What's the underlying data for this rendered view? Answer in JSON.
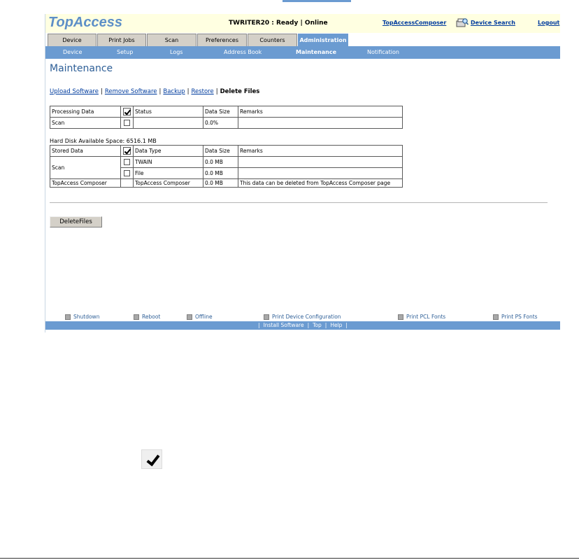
{
  "header": {
    "logo": "TopAccess",
    "status": "TWRITER20 : Ready | Online",
    "composer_link": "TopAccessComposer",
    "device_search_link": "Device Search",
    "logout_link": "Logout"
  },
  "tabs": [
    "Device",
    "Print Jobs",
    "Scan",
    "Preferences",
    "Counters",
    "Administration"
  ],
  "subnav": [
    "Device",
    "Setup",
    "Logs",
    "Address Book",
    "Maintenance",
    "Notification"
  ],
  "page_title": "Maintenance",
  "link_bar": {
    "upload": "Upload Software",
    "remove": "Remove Software",
    "backup": "Backup",
    "restore": "Restore",
    "current": "Delete Files",
    "sep": "|"
  },
  "processing_table": {
    "headers": [
      "Processing Data",
      "",
      "Status",
      "Data Size",
      "Remarks"
    ],
    "rows": [
      [
        "Scan",
        "",
        "",
        "0.0%",
        ""
      ]
    ]
  },
  "disk_space": "Hard Disk Available Space: 6516.1 MB",
  "stored_table": {
    "headers": [
      "Stored Data",
      "",
      "Data Type",
      "Data Size",
      "Remarks"
    ],
    "scan_label": "Scan",
    "twain": {
      "type": "TWAIN",
      "size": "0.0 MB",
      "remarks": ""
    },
    "file": {
      "type": "File",
      "size": "0.0 MB",
      "remarks": ""
    },
    "composer": {
      "label": "TopAccess Composer",
      "type": "TopAccess Composer",
      "size": "0.0 MB",
      "remarks": "This data can be deleted from TopAccess Composer page"
    }
  },
  "delete_button": "DeleteFiles",
  "footer": {
    "items": [
      "Shutdown",
      "Reboot",
      "Offline",
      "Print Device Configuration",
      "Print PCL Fonts",
      "Print PS Fonts"
    ],
    "links": [
      "Install Software",
      "Top",
      "Help"
    ],
    "sep": "|"
  },
  "colors": {
    "accent": "#6b9bd1",
    "header_bg": "#ffffe1",
    "title": "#2e5f97",
    "link": "#003c9e"
  }
}
